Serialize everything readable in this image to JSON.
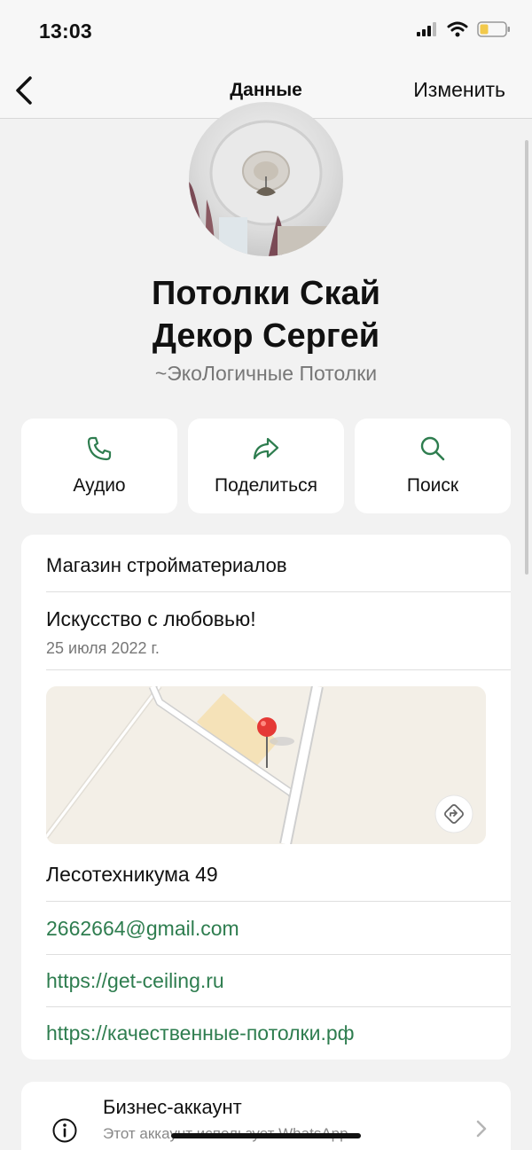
{
  "status_bar": {
    "time": "13:03"
  },
  "nav": {
    "title": "Данные",
    "edit_label": "Изменить"
  },
  "profile": {
    "name": "Потолки Скай\nДекор Сергей",
    "subtitle": "~ЭкоЛогичные Потолки"
  },
  "actions": [
    {
      "label": "Аудио",
      "icon": "phone-icon"
    },
    {
      "label": "Поделиться",
      "icon": "share-icon"
    },
    {
      "label": "Поиск",
      "icon": "search-icon"
    }
  ],
  "info": {
    "category": "Магазин стройматериалов",
    "about": "Искусство с любовью!",
    "about_date": "25 июля 2022 г.",
    "address": "Лесотехникума 49",
    "email": "2662664@gmail.com",
    "website_1": "https://get-ceiling.ru",
    "website_2": "https://качественные-потолки.рф"
  },
  "business": {
    "title": "Бизнес-аккаунт",
    "description": "Этот аккаунт использует WhatsApp"
  },
  "colors": {
    "accent": "#2e7d4f",
    "background": "#f2f2f2"
  }
}
